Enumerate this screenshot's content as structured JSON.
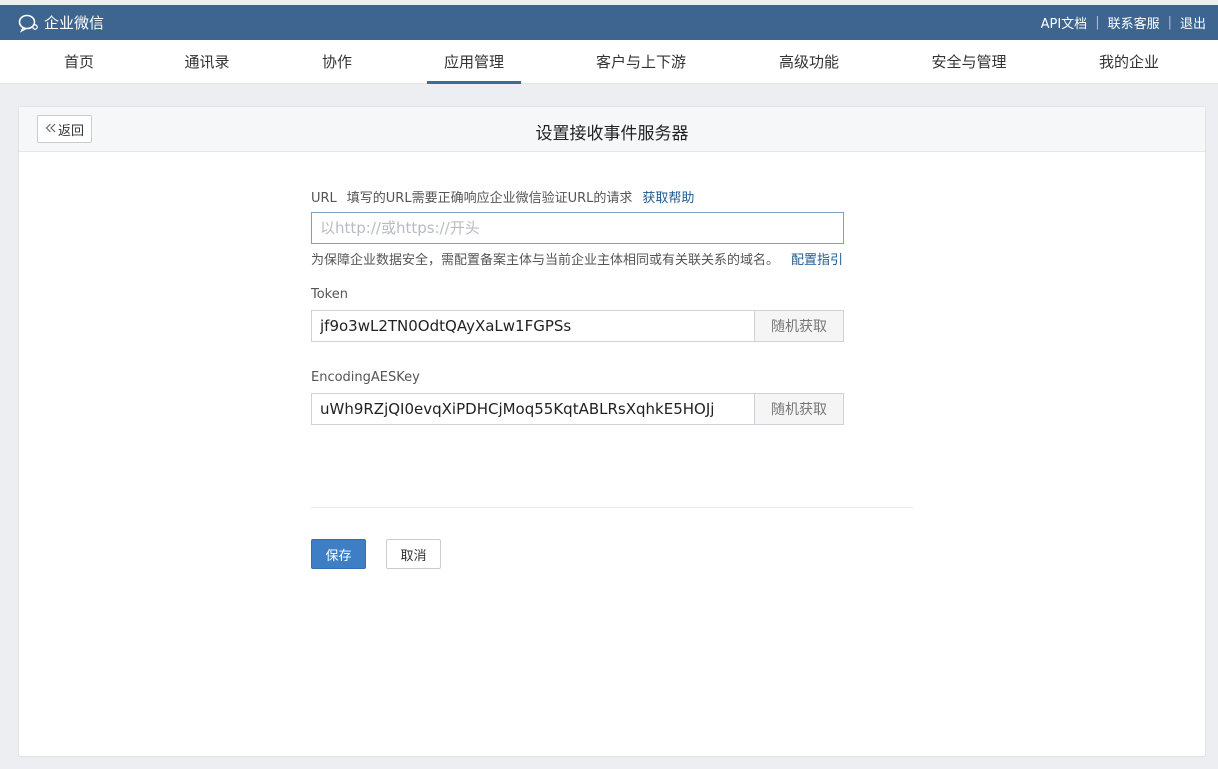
{
  "topbar": {
    "brand": "企业微信",
    "links": [
      "API文档",
      "联系客服",
      "退出"
    ]
  },
  "nav": {
    "items": [
      {
        "label": "首页"
      },
      {
        "label": "通讯录"
      },
      {
        "label": "协作"
      },
      {
        "label": "应用管理",
        "active": true
      },
      {
        "label": "客户与上下游"
      },
      {
        "label": "高级功能"
      },
      {
        "label": "安全与管理"
      },
      {
        "label": "我的企业"
      }
    ]
  },
  "panel": {
    "back_label": "返回",
    "title": "设置接收事件服务器"
  },
  "form": {
    "url": {
      "label": "URL",
      "hint": "填写的URL需要正确响应企业微信验证URL的请求",
      "help_link": "获取帮助",
      "placeholder": "以http://或https://开头",
      "value": "",
      "note": "为保障企业数据安全，需配置备案主体与当前企业主体相同或有关联关系的域名。",
      "note_link": "配置指引"
    },
    "token": {
      "label": "Token",
      "value": "jf9o3wL2TN0OdtQAyXaLw1FGPSs",
      "button": "随机获取"
    },
    "aes": {
      "label": "EncodingAESKey",
      "value": "uWh9RZjQI0evqXiPDHCjMoq55KqtABLRsXqhkE5HOJj",
      "button": "随机获取"
    },
    "save": "保存",
    "cancel": "取消"
  },
  "colors": {
    "topbar": "#3d6590",
    "nav_active_underline": "#3d6a9a",
    "link": "#1f5a91",
    "primary_button": "#3d7ec4"
  }
}
